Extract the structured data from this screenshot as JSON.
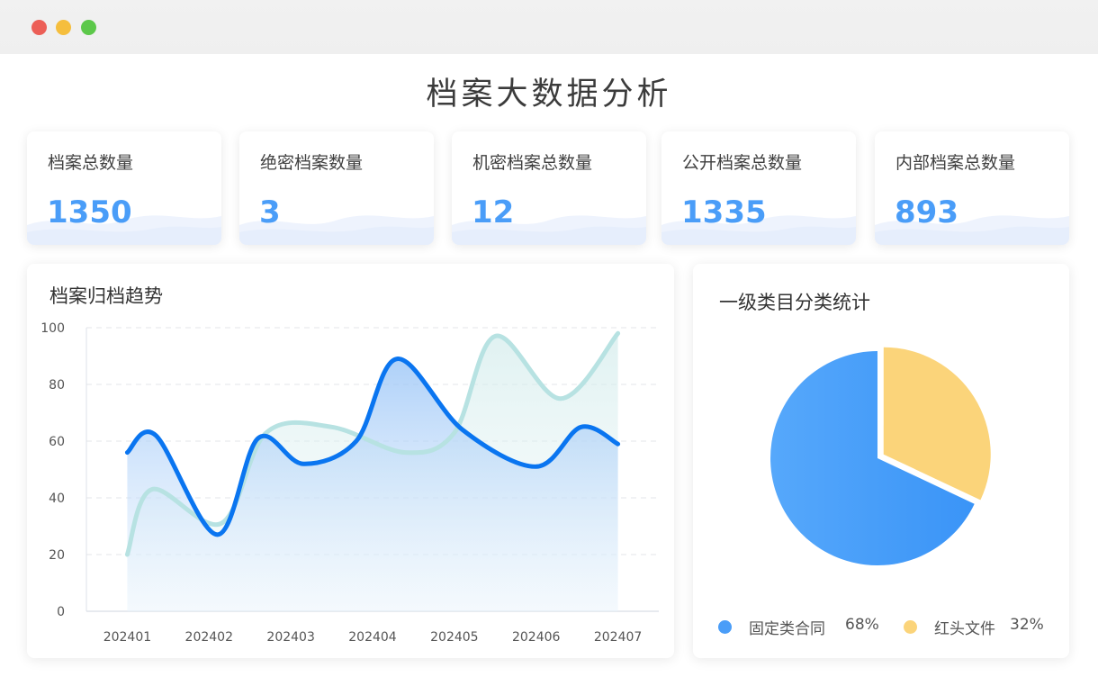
{
  "page": {
    "title": "档案大数据分析"
  },
  "stats": [
    {
      "label": "档案总数量",
      "value": "1350"
    },
    {
      "label": "绝密档案数量",
      "value": "3"
    },
    {
      "label": "机密档案总数量",
      "value": "12"
    },
    {
      "label": "公开档案总数量",
      "value": "1335"
    },
    {
      "label": "内部档案总数量",
      "value": "893"
    }
  ],
  "colors": {
    "accent": "#4a9df8",
    "series1": "#0a75f0",
    "series2": "#b7e2e2",
    "pie_blue": "#4a9df8",
    "pie_yellow": "#fbd47a"
  },
  "trend": {
    "title": "档案归档趋势",
    "chart_data": {
      "type": "line",
      "categories": [
        "202401",
        "202402",
        "202403",
        "202404",
        "202405",
        "202406",
        "202407"
      ],
      "ylim": [
        0,
        100
      ],
      "yticks": [
        "0",
        "20",
        "40",
        "60",
        "80",
        "100"
      ],
      "grid": true,
      "smooth": true,
      "series": [
        {
          "color": "#b7e2e2",
          "x": [
            0,
            0.3,
            1.15,
            1.7,
            2.5,
            3.4,
            4,
            4.5,
            5.3,
            6.0
          ],
          "values": [
            20,
            43,
            31,
            63,
            65,
            56,
            63,
            97,
            75,
            98
          ]
        },
        {
          "color": "#0a75f0",
          "x": [
            0,
            0.35,
            1.1,
            1.6,
            2.15,
            2.8,
            3.3,
            4.1,
            5.0,
            5.55,
            6.0
          ],
          "values": [
            56,
            62,
            27,
            61,
            52,
            60,
            89,
            64,
            51,
            65,
            59
          ]
        }
      ]
    }
  },
  "category": {
    "title": "一级类目分类统计",
    "chart_data": {
      "type": "pie",
      "slices": [
        {
          "name": "固定类合同",
          "value": 68,
          "pct": "68%",
          "color": "#4a9df8"
        },
        {
          "name": "红头文件",
          "value": 32,
          "pct": "32%",
          "color": "#fbd47a"
        }
      ]
    }
  }
}
